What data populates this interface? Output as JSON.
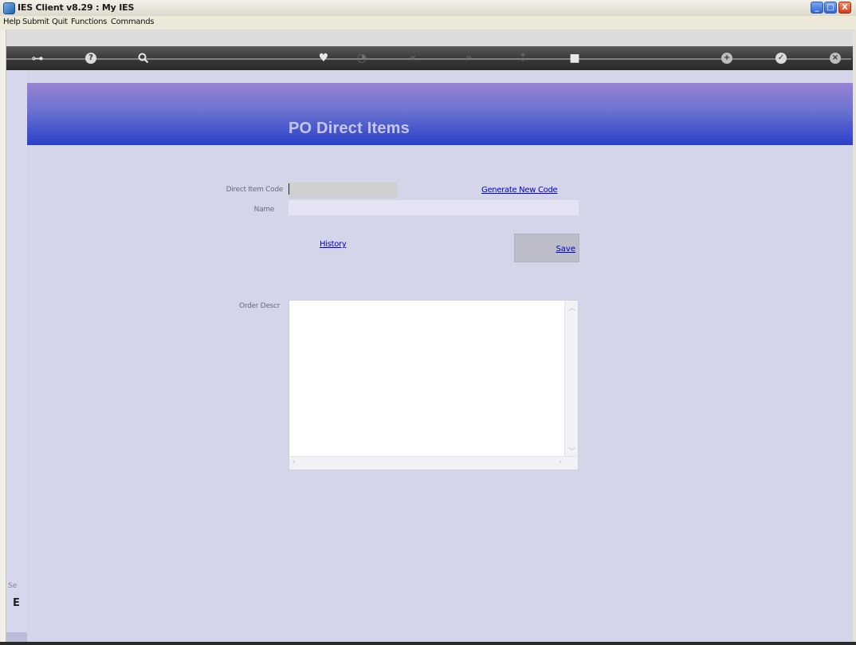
{
  "window": {
    "title": "IES Client v8.29 : My IES",
    "minimize": "_",
    "maximize": "□",
    "close": "X"
  },
  "menu": {
    "items": [
      "Help",
      "Submit",
      "Quit",
      "Functions",
      "Commands"
    ]
  },
  "toolbar": {
    "icons": [
      "key-icon",
      "help-icon",
      "search-icon",
      "heart-icon",
      "clock-icon",
      "rewind-icon",
      "fast-forward-icon",
      "upload-icon",
      "stop-icon",
      "add-icon",
      "check-icon",
      "close-icon"
    ]
  },
  "page": {
    "title": "PO Direct Items"
  },
  "form": {
    "direct_item_code_label": "Direct Item Code",
    "direct_item_code_value": "",
    "name_label": "Name",
    "name_value": "",
    "generate_link": "Generate New Code",
    "history_link": "History",
    "save_button": "Save",
    "order_descr_label": "Order Descr",
    "order_descr_value": ""
  },
  "status": {
    "side_text": "Se",
    "side_glyph": "E"
  },
  "colors": {
    "header_top": "#9a82d2",
    "header_bottom": "#2a40c8",
    "body_bg": "#d5d5e9",
    "link": "#0000cc"
  }
}
